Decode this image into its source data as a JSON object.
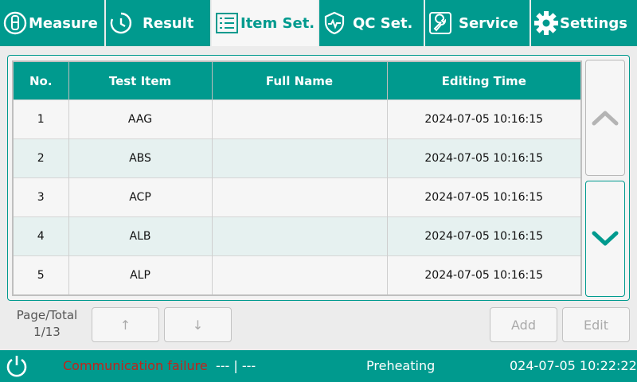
{
  "tabs": [
    {
      "label": "Measure",
      "icon": "test-tube-icon"
    },
    {
      "label": "Result",
      "icon": "clock-icon"
    },
    {
      "label": "Item Set.",
      "icon": "list-icon",
      "active": true
    },
    {
      "label": "QC Set.",
      "icon": "shield-icon"
    },
    {
      "label": "Service",
      "icon": "wrench-icon"
    },
    {
      "label": "Settings",
      "icon": "gear-icon"
    }
  ],
  "table": {
    "headers": [
      "No.",
      "Test Item",
      "Full Name",
      "Editing Time"
    ],
    "rows": [
      [
        "1",
        "AAG",
        "",
        "2024-07-05 10:16:15"
      ],
      [
        "2",
        "ABS",
        "",
        "2024-07-05 10:16:15"
      ],
      [
        "3",
        "ACP",
        "",
        "2024-07-05 10:16:15"
      ],
      [
        "4",
        "ALB",
        "",
        "2024-07-05 10:16:15"
      ],
      [
        "5",
        "ALP",
        "",
        "2024-07-05 10:16:15"
      ]
    ]
  },
  "pagination": {
    "label": "Page/Total",
    "value": "1/13",
    "prev_label": "↑",
    "next_label": "↓"
  },
  "actions": {
    "add_label": "Add",
    "edit_label": "Edit"
  },
  "status": {
    "comm_error": "Communication failure",
    "comm_value": "--- | ---",
    "state": "Preheating",
    "datetime": "024-07-05 10:22:22"
  },
  "colors": {
    "accent": "#009a8e",
    "error": "#c0241b"
  }
}
